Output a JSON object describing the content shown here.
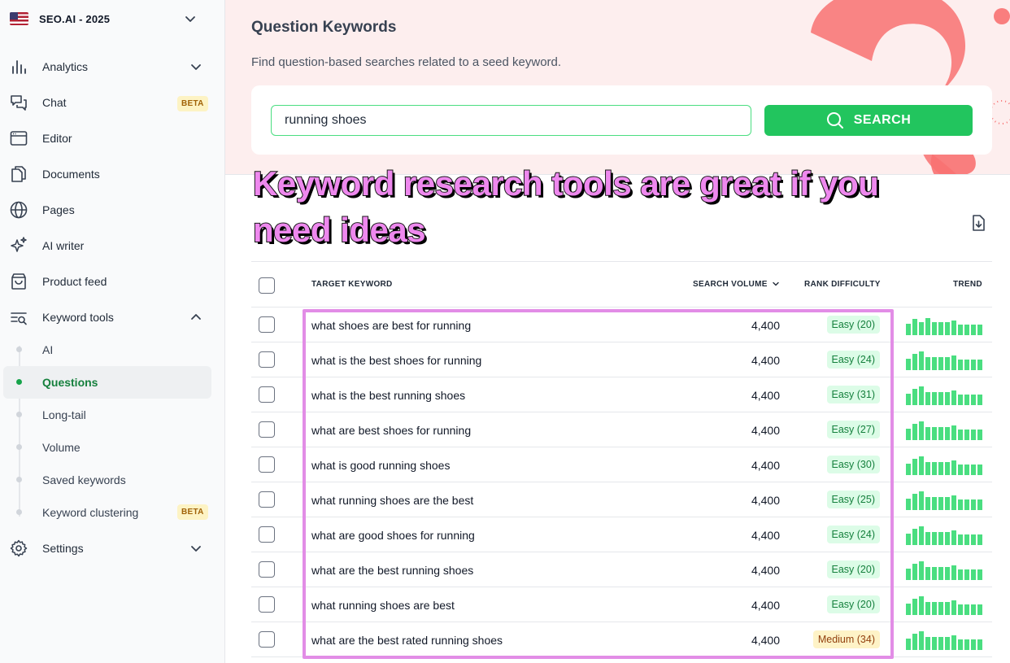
{
  "workspace": {
    "name": "SEO.AI - 2025",
    "flag_icon": "us-flag-icon"
  },
  "sidebar": {
    "items": [
      {
        "label": "Analytics",
        "icon": "bar-chart-icon",
        "chevron": "down"
      },
      {
        "label": "Chat",
        "icon": "chat-bubbles-icon",
        "badge": "BETA"
      },
      {
        "label": "Editor",
        "icon": "browser-window-icon"
      },
      {
        "label": "Documents",
        "icon": "documents-icon"
      },
      {
        "label": "Pages",
        "icon": "globe-icon"
      },
      {
        "label": "AI writer",
        "icon": "sparkles-icon"
      },
      {
        "label": "Product feed",
        "icon": "shopping-bag-icon"
      },
      {
        "label": "Keyword tools",
        "icon": "keyword-search-icon",
        "chevron": "up"
      },
      {
        "label": "Settings",
        "icon": "gear-icon",
        "chevron": "down"
      }
    ],
    "keyword_sub": [
      {
        "label": "AI"
      },
      {
        "label": "Questions",
        "active": true
      },
      {
        "label": "Long-tail"
      },
      {
        "label": "Volume"
      },
      {
        "label": "Saved keywords"
      },
      {
        "label": "Keyword clustering",
        "badge": "BETA"
      }
    ]
  },
  "header": {
    "title": "Question Keywords",
    "subtitle": "Find question-based searches related to a seed keyword.",
    "search_value": "running shoes",
    "search_button": "SEARCH"
  },
  "overlay": {
    "line1": "Keyword research tools are great if you",
    "line2": "need ideas"
  },
  "table": {
    "columns": {
      "keyword": "TARGET KEYWORD",
      "volume": "SEARCH VOLUME",
      "difficulty": "RANK DIFFICULTY",
      "trend": "TREND"
    },
    "rows": [
      {
        "keyword": "what shoes are best for running",
        "volume": "4,400",
        "difficulty": "Easy (20)",
        "level": "easy",
        "trend": [
          0.55,
          0.75,
          0.6,
          0.8,
          0.6,
          0.6,
          0.6,
          0.7,
          0.5,
          0.5,
          0.5,
          0.5
        ]
      },
      {
        "keyword": "what is the best shoes for running",
        "volume": "4,400",
        "difficulty": "Easy (24)",
        "level": "easy",
        "trend": [
          0.55,
          0.75,
          0.9,
          0.6,
          0.6,
          0.6,
          0.6,
          0.7,
          0.5,
          0.5,
          0.5,
          0.5
        ]
      },
      {
        "keyword": "what is the best running shoes",
        "volume": "4,400",
        "difficulty": "Easy (31)",
        "level": "easy",
        "trend": [
          0.55,
          0.75,
          0.9,
          0.6,
          0.6,
          0.6,
          0.6,
          0.7,
          0.5,
          0.5,
          0.5,
          0.5
        ]
      },
      {
        "keyword": "what are best shoes for running",
        "volume": "4,400",
        "difficulty": "Easy (27)",
        "level": "easy",
        "trend": [
          0.55,
          0.75,
          0.9,
          0.6,
          0.6,
          0.6,
          0.6,
          0.7,
          0.5,
          0.5,
          0.5,
          0.5
        ]
      },
      {
        "keyword": "what is good running shoes",
        "volume": "4,400",
        "difficulty": "Easy (30)",
        "level": "easy",
        "trend": [
          0.55,
          0.75,
          0.9,
          0.6,
          0.6,
          0.6,
          0.6,
          0.7,
          0.5,
          0.5,
          0.5,
          0.5
        ]
      },
      {
        "keyword": "what running shoes are the best",
        "volume": "4,400",
        "difficulty": "Easy (25)",
        "level": "easy",
        "trend": [
          0.55,
          0.75,
          0.9,
          0.6,
          0.6,
          0.6,
          0.6,
          0.7,
          0.5,
          0.5,
          0.5,
          0.5
        ]
      },
      {
        "keyword": "what are good shoes for running",
        "volume": "4,400",
        "difficulty": "Easy (24)",
        "level": "easy",
        "trend": [
          0.55,
          0.75,
          0.9,
          0.6,
          0.6,
          0.6,
          0.6,
          0.7,
          0.5,
          0.5,
          0.5,
          0.5
        ]
      },
      {
        "keyword": "what are the best running shoes",
        "volume": "4,400",
        "difficulty": "Easy (20)",
        "level": "easy",
        "trend": [
          0.55,
          0.75,
          0.9,
          0.6,
          0.6,
          0.6,
          0.6,
          0.7,
          0.5,
          0.5,
          0.5,
          0.5
        ]
      },
      {
        "keyword": "what running shoes are best",
        "volume": "4,400",
        "difficulty": "Easy (20)",
        "level": "easy",
        "trend": [
          0.55,
          0.75,
          0.9,
          0.6,
          0.6,
          0.6,
          0.6,
          0.7,
          0.5,
          0.5,
          0.5,
          0.5
        ]
      },
      {
        "keyword": "what are the best rated running shoes",
        "volume": "4,400",
        "difficulty": "Medium (34)",
        "level": "medium",
        "trend": [
          0.55,
          0.75,
          0.9,
          0.6,
          0.6,
          0.6,
          0.6,
          0.7,
          0.5,
          0.5,
          0.5,
          0.5
        ]
      }
    ]
  },
  "colors": {
    "accent": "#22c55e",
    "hero_bg": "#fdeeee",
    "highlight": "#e28de6",
    "overlay_text": "#ee88ee"
  }
}
